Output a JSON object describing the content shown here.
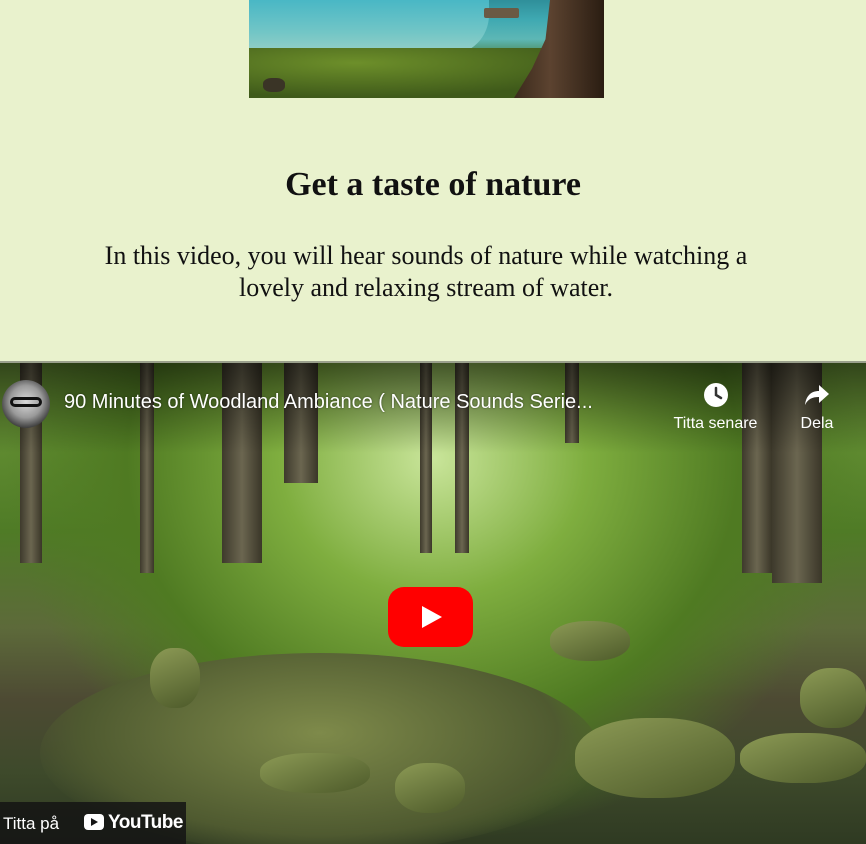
{
  "article": {
    "heading": "Get a taste of nature",
    "intro": "In this video, you will hear sounds of nature while watching a lovely and relaxing stream of water."
  },
  "video": {
    "title": "90 Minutes of Woodland Ambiance ( Nature Sounds Serie...",
    "watch_later_label": "Titta senare",
    "share_label": "Dela",
    "watch_on_label": "Titta på",
    "platform_name": "YouTube"
  },
  "colors": {
    "page_background": "#e9f2cd",
    "play_button": "#ff0000"
  },
  "icons": [
    "clock-icon",
    "share-arrow-icon",
    "play-icon",
    "youtube-logo-icon"
  ]
}
